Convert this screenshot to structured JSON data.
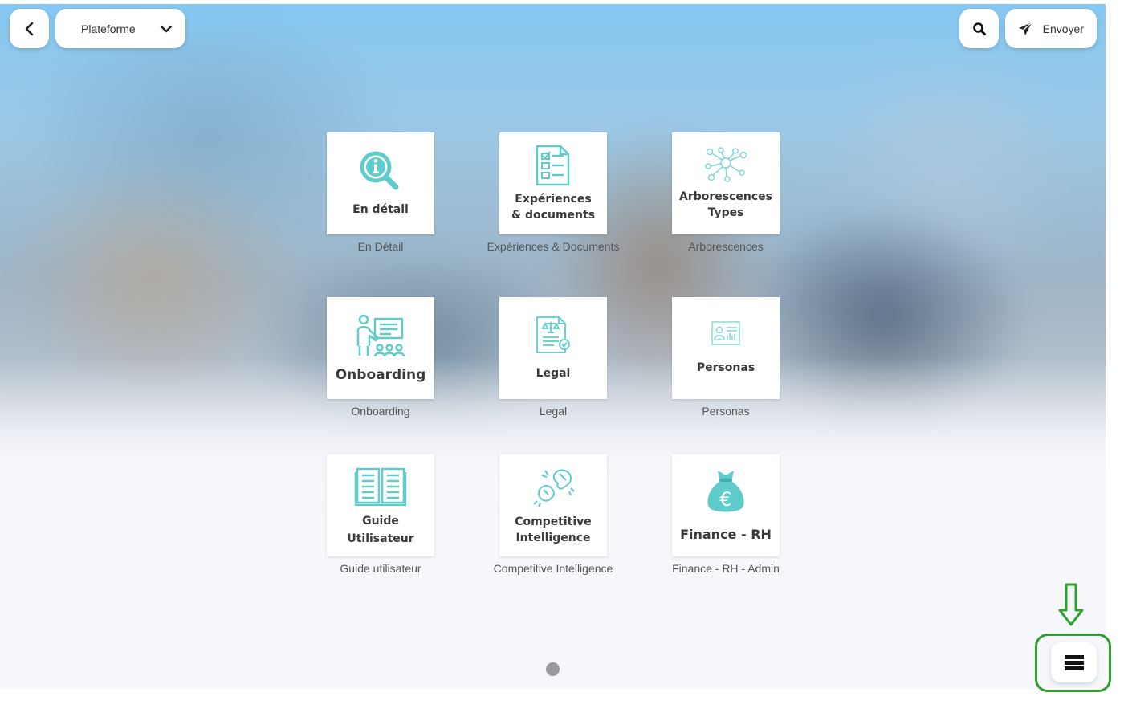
{
  "toolbar": {
    "platform_label": "Plateforme",
    "send_label": "Envoyer"
  },
  "tiles": [
    {
      "title": "En détail",
      "caption": "En Détail",
      "icon": "magnifier-info-icon"
    },
    {
      "title": "Expériences\n& documents",
      "caption": "Expériences & Documents",
      "icon": "checklist-document-icon"
    },
    {
      "title": "Arborescences\nTypes",
      "caption": "Arborescences",
      "icon": "network-tree-icon"
    },
    {
      "title": "Onboarding",
      "caption": "Onboarding",
      "icon": "presenter-board-icon"
    },
    {
      "title": "Legal",
      "caption": "Legal",
      "icon": "legal-document-icon"
    },
    {
      "title": "Personas",
      "caption": "Personas",
      "icon": "id-card-icon"
    },
    {
      "title": "Guide\nUtilisateur",
      "caption": "Guide utilisateur",
      "icon": "open-book-icon"
    },
    {
      "title": "Competitive\nIntelligence",
      "caption": "Competitive Intelligence",
      "icon": "boxing-gloves-icon"
    },
    {
      "title": "Finance - RH",
      "caption": "Finance - RH - Admin",
      "icon": "money-bag-euro-icon"
    }
  ],
  "pagination": {
    "pages": 1,
    "current": 1
  },
  "colors": {
    "accent": "#5fcbcb",
    "highlight": "#2fa02f"
  }
}
